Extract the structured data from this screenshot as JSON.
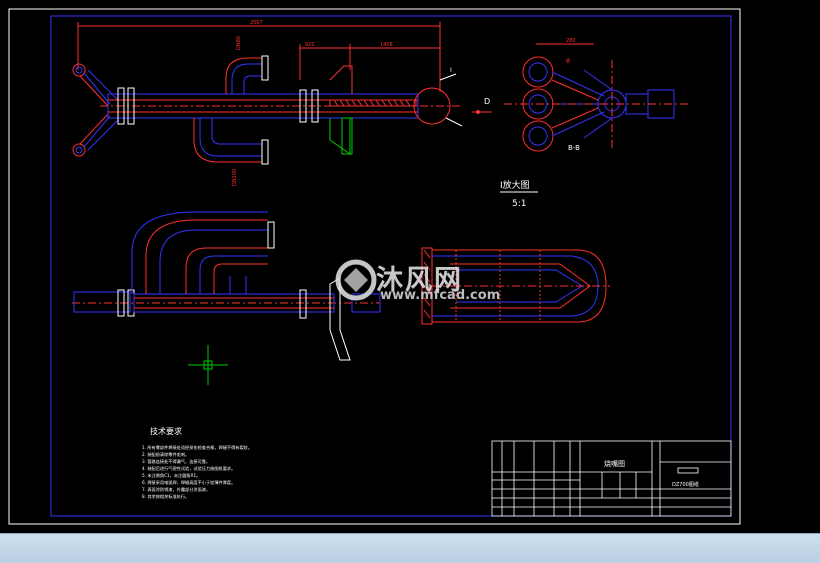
{
  "drawing": {
    "labels": {
      "view_label": "I放大图",
      "view_scale": "5:1",
      "section_mark": "I",
      "section_b": "B-B",
      "detail_d": "D"
    },
    "tech_req": {
      "title": "技术要求",
      "items": [
        "1. 所有零部件焊接处须经探伤检查合格，焊缝不得有裂纹。",
        "2. 装配前清除零件毛刺。",
        "3. 管路连接处不得漏气，连接可靠。",
        "4. 装配后进行气密性试验，试验压力按图纸要求。",
        "5. 未注倒角C1，未注圆角R1。",
        "6. 焊接采用电弧焊，焊缝高度不小于较薄件厚度。",
        "7. 表面涂防锈漆，外露部分涂面漆。",
        "8. 其余按相关标准执行。"
      ]
    },
    "title_block": {
      "drawing_title": "烧嘴图",
      "company": "DZ700图纸"
    }
  },
  "watermark": {
    "text": "沐风网",
    "url": "www.mfcad.com"
  },
  "colors": {
    "background": "#000000",
    "frame": "#ffffff",
    "outline": "#0000ff",
    "line_red": "#ff2020",
    "line_blue": "#2020ff",
    "line_white": "#ffffff",
    "line_green": "#00cc00",
    "line_magenta": "#ff00ff",
    "statusbar": "#c7dbeb"
  }
}
